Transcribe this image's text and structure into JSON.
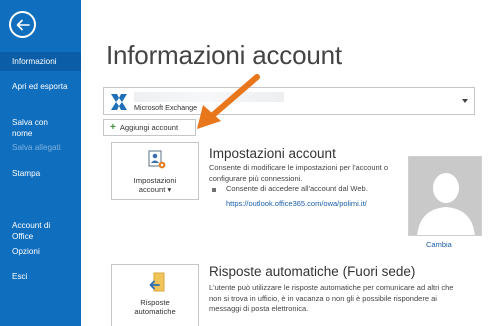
{
  "sidebar": {
    "colors": {
      "background": "#106ebe",
      "active": "#0a5da6",
      "disabled_text": "#7fb2de"
    },
    "back_icon": "arrow-left-circle-icon",
    "items": [
      {
        "label": "Informazioni",
        "state": "active"
      },
      {
        "label": "Apri ed esporta"
      },
      {
        "label": "Salva con\nnome"
      },
      {
        "label": "Salva allegati",
        "state": "disabled"
      },
      {
        "label": "Stampa"
      },
      {
        "label": "Account di\nOffice"
      },
      {
        "label": "Opzioni"
      },
      {
        "label": "Esci"
      }
    ]
  },
  "main": {
    "title": "Informazioni account",
    "account_selector": {
      "icon": "exchange-icon",
      "account_type": "Microsoft Exchange"
    },
    "add_account_label": "Aggiungi account",
    "account_settings": {
      "tile_label_line1": "Impostazioni",
      "tile_label_line2": "account ▾",
      "title": "Impostazioni account",
      "description": "Consente di modificare le impostazioni per l'account o configurare più connessioni.",
      "bullet": "Consente di accedere all'account dal Web.",
      "link": "https://outlook.office365.com/owa/polimi.it/"
    },
    "profile": {
      "change_label": "Cambia",
      "avatar_icon": "person-silhouette-icon"
    },
    "auto_replies": {
      "tile_label_line1": "Risposte",
      "tile_label_line2": "automatiche",
      "title": "Risposte automatiche (Fuori sede)",
      "description": "L'utente può utilizzare le risposte automatiche per comunicare ad altri che non si trova in ufficio, è in vacanza o non gli è possibile rispondere ai messaggi di posta elettronica."
    },
    "annotation": {
      "icon": "orange-arrow-icon",
      "color": "#e8761b"
    }
  }
}
